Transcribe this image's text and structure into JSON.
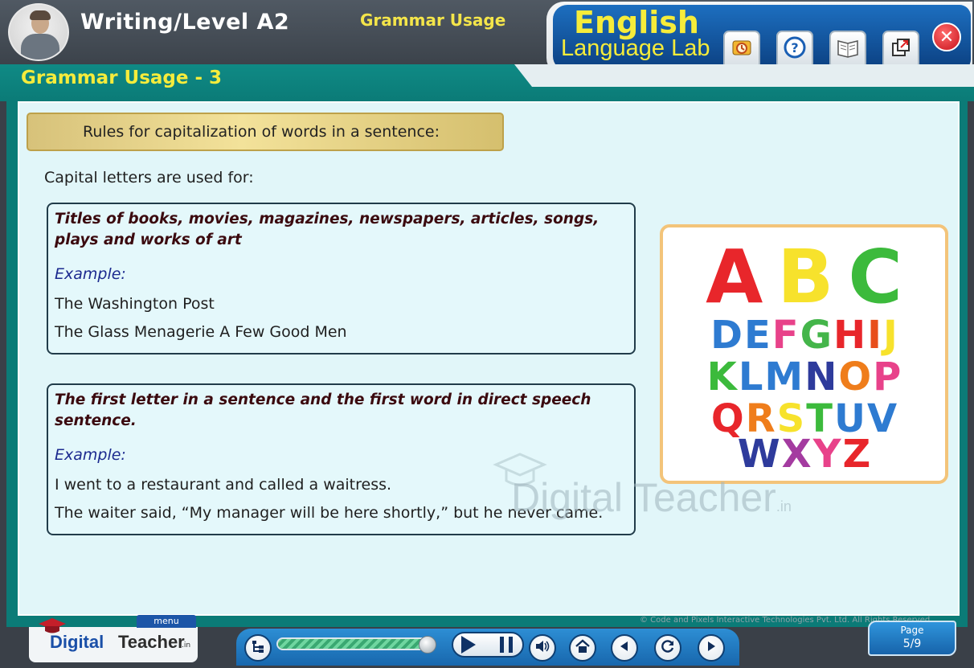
{
  "header": {
    "title": "Writing/Level A2",
    "subtitle": "Grammar Usage",
    "brand_line1": "English",
    "brand_line2": "Language Lab",
    "tool_icons": [
      "glossary-icon",
      "help-icon",
      "book-icon",
      "popout-icon"
    ],
    "close_symbol": "✕"
  },
  "lesson_title": "Grammar Usage - 3",
  "banner": "Rules for capitalization of words in a sentence:",
  "intro": "Capital letters are used for:",
  "cards": [
    {
      "heading": "Titles of books, movies, magazines, newspapers, articles, songs, plays and works of art",
      "example_label": "Example:",
      "examples": [
        "The Washington Post",
        "The Glass Menagerie A Few Good Men"
      ]
    },
    {
      "heading": "The first letter in a sentence and the first word in direct speech sentence.",
      "example_label": "Example:",
      "examples": [
        "I went to a restaurant and called a waitress.",
        "The waiter said, “My manager will be here shortly,” but he never came."
      ]
    }
  ],
  "alphabet": {
    "big": [
      {
        "ch": "A",
        "color": "#e8262b"
      },
      {
        "ch": "B",
        "color": "#f7e22c"
      },
      {
        "ch": "C",
        "color": "#3cba3c"
      }
    ],
    "rows": [
      [
        {
          "ch": "D",
          "color": "#2e7bd1"
        },
        {
          "ch": "E",
          "color": "#2e7bd1"
        },
        {
          "ch": "F",
          "color": "#e8428a"
        },
        {
          "ch": "G",
          "color": "#44b54a"
        },
        {
          "ch": "H",
          "color": "#e8262b"
        },
        {
          "ch": "I",
          "color": "#e84e1b"
        },
        {
          "ch": "J",
          "color": "#f7e22c"
        }
      ],
      [
        {
          "ch": "K",
          "color": "#3cba3c"
        },
        {
          "ch": "L",
          "color": "#2e7bd1"
        },
        {
          "ch": "M",
          "color": "#2e7bd1"
        },
        {
          "ch": "N",
          "color": "#2e3b9c"
        },
        {
          "ch": "O",
          "color": "#ef7d1b"
        },
        {
          "ch": "P",
          "color": "#e8428a"
        }
      ],
      [
        {
          "ch": "Q",
          "color": "#e8262b"
        },
        {
          "ch": "R",
          "color": "#ef7d1b"
        },
        {
          "ch": "S",
          "color": "#f7e22c"
        },
        {
          "ch": "T",
          "color": "#3cba3c"
        },
        {
          "ch": "U",
          "color": "#2e7bd1"
        },
        {
          "ch": "V",
          "color": "#2e7bd1"
        }
      ],
      [
        {
          "ch": "W",
          "color": "#2e3b9c"
        },
        {
          "ch": "X",
          "color": "#a43ba0"
        },
        {
          "ch": "Y",
          "color": "#e8428a"
        },
        {
          "ch": "Z",
          "color": "#e8262b"
        }
      ]
    ]
  },
  "watermark": {
    "word1": "Digital",
    "word2": "Teacher",
    "domain": ".in"
  },
  "footer": {
    "menu_label": "menu",
    "logo_digital": "Digital",
    "logo_teacher": "Teacher",
    "logo_domain": ".in",
    "copyright": "© Code and Pixels Interactive Technologies  Pvt. Ltd. All Rights Reserved.",
    "progress": 0.97,
    "page_label": "Page",
    "page_number": "5/9"
  },
  "colors": {
    "accent_yellow": "#f5ec3c",
    "teal": "#0b7b77",
    "brand_blue": "#1d6fc0"
  }
}
